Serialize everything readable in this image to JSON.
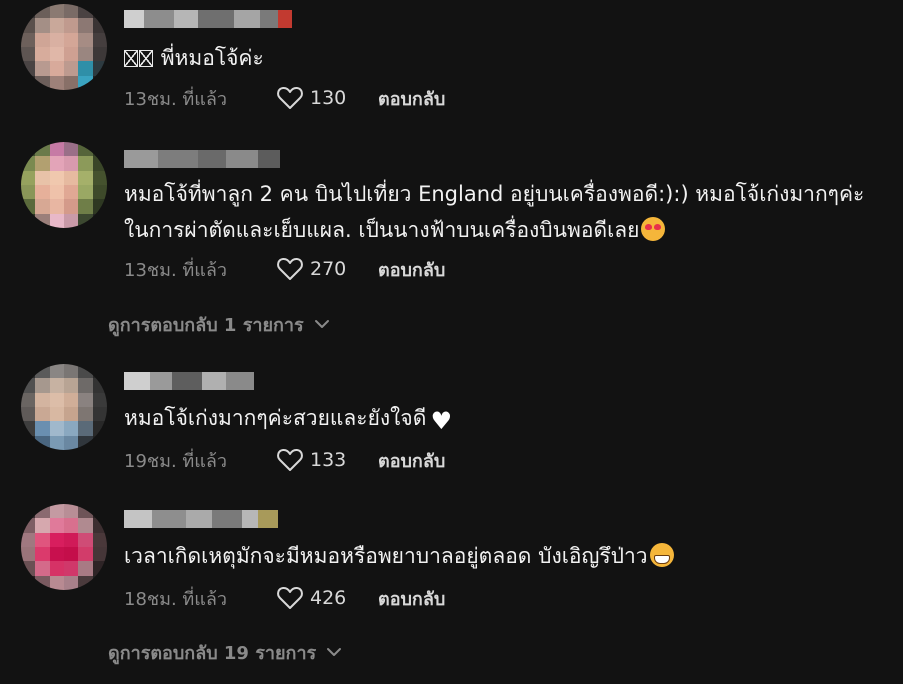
{
  "comments": [
    {
      "text": "พี่หมอโจ้ค่ะ",
      "time": "13ชม. ที่แล้ว",
      "likes": "130",
      "reply": "ตอบกลับ",
      "icons": [
        "missing-glyph-icon",
        "heart-outline-icon"
      ]
    },
    {
      "text": "หมอโจ้ที่พาลูก 2 คน บินไปเที่ยว England อยู่บนเครื่องพอดี:):) หมอโจ้เก่งมากๆค่ะในการผ่าตัดและเย็บแผล. เป็นนางฟ้าบนเครื่องบินพอดีเลย",
      "time": "13ชม. ที่แล้ว",
      "likes": "270",
      "reply": "ตอบกลับ",
      "icons": [
        "smiling-face-with-hearts-icon",
        "heart-outline-icon"
      ]
    },
    {
      "text": "หมอโจ้เก่งมากๆค่ะสวยและยังใจดี",
      "time": "19ชม. ที่แล้ว",
      "likes": "133",
      "reply": "ตอบกลับ",
      "icons": [
        "white-heart-icon",
        "heart-outline-icon"
      ]
    },
    {
      "text": "เวลาเกิดเหตุมักจะมีหมอหรือพยาบาลอยู่ตลอด บังเอิญรึป่าว",
      "time": "18ชม. ที่แล้ว",
      "likes": "426",
      "reply": "ตอบกลับ",
      "icons": [
        "grinning-face-icon",
        "heart-outline-icon"
      ]
    }
  ],
  "view_replies": [
    {
      "label": "ดูการตอบกลับ 1 รายการ",
      "icon": "chevron-down-icon"
    },
    {
      "label": "ดูการตอบกลับ 19 รายการ",
      "icon": "chevron-down-icon"
    }
  ],
  "colors": {
    "background": "#121212",
    "text": "#f2f2f2",
    "muted": "#8a8a8a",
    "action": "#d8d8d8"
  }
}
